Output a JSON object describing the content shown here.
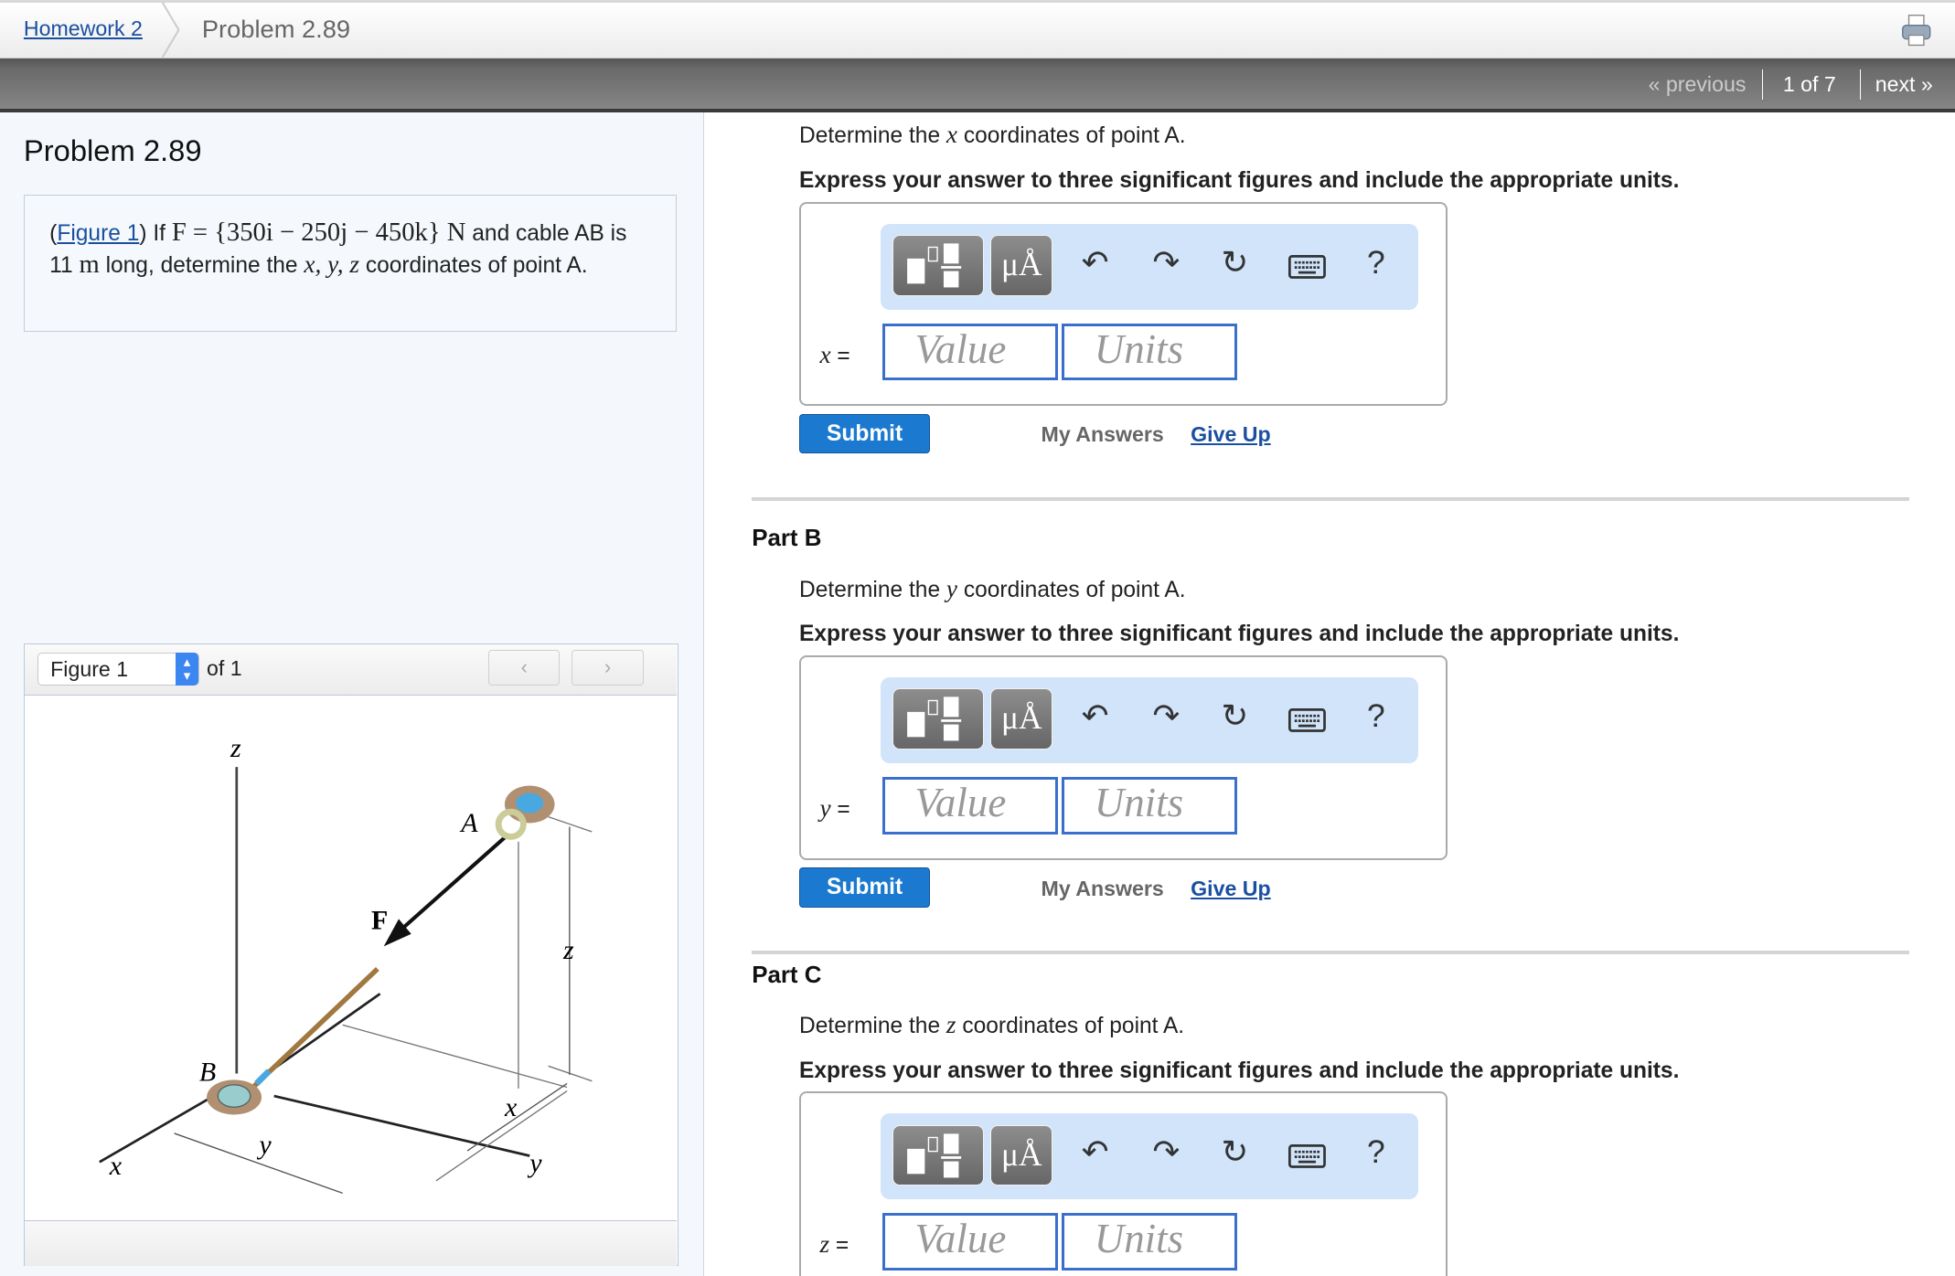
{
  "breadcrumb": {
    "home": "Homework 2",
    "current": "Problem 2.89"
  },
  "icons": {
    "print": "printer-icon",
    "undo": "undo-icon",
    "redo": "redo-icon",
    "reset": "reset-icon",
    "keyboard": "keyboard-icon",
    "help": "help-icon"
  },
  "nav": {
    "previous": "« previous",
    "count": "1 of 7",
    "next": "next »"
  },
  "problem": {
    "title": "Problem 2.89",
    "figure_link": "Figure 1",
    "text_if": "If",
    "force": "F = {350i − 250j − 450k} N",
    "text_and": "and cable AB is 11",
    "unit_m": "m",
    "text_long": "long, determine the",
    "vars": "x, y, z",
    "text_end": "coordinates of point A."
  },
  "figure": {
    "selected": "Figure 1",
    "of": "of 1",
    "prev": "‹",
    "next": "›",
    "labels": {
      "z_axis": "z",
      "x_axis": "x",
      "y_axis": "y",
      "A": "A",
      "B": "B",
      "F": "F",
      "dim_z": "z",
      "dim_x": "x",
      "dim_y": "y"
    }
  },
  "toolbar": {
    "units_btn": "μÅ",
    "help": "?"
  },
  "parts": [
    {
      "label": "",
      "prompt_pre": "Determine the",
      "var": "x",
      "prompt_post": "coordinates of point A.",
      "instruction": "Express your answer to three significant figures and include the appropriate units.",
      "eq": "=",
      "value_placeholder": "Value",
      "units_placeholder": "Units",
      "submit": "Submit",
      "my_answers": "My Answers",
      "give_up": "Give Up"
    },
    {
      "label": "Part B",
      "prompt_pre": "Determine the",
      "var": "y",
      "prompt_post": "coordinates of point A.",
      "instruction": "Express your answer to three significant figures and include the appropriate units.",
      "eq": "=",
      "value_placeholder": "Value",
      "units_placeholder": "Units",
      "submit": "Submit",
      "my_answers": "My Answers",
      "give_up": "Give Up"
    },
    {
      "label": "Part C",
      "prompt_pre": "Determine the",
      "var": "z",
      "prompt_post": "coordinates of point A.",
      "instruction": "Express your answer to three significant figures and include the appropriate units.",
      "eq": "=",
      "value_placeholder": "Value",
      "units_placeholder": "Units"
    }
  ],
  "colors": {
    "link": "#1a4fa0",
    "submit": "#1b7ad0",
    "toolbar_bg": "#d1e4fa",
    "field_border": "#3a6fcd"
  }
}
